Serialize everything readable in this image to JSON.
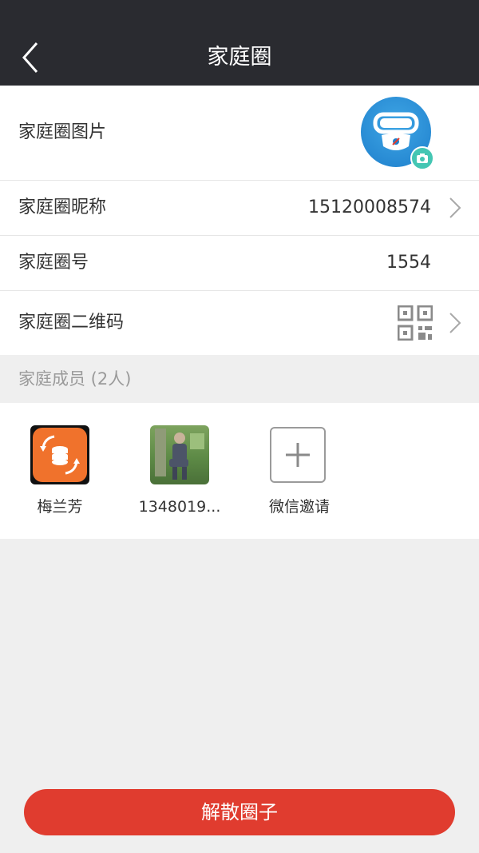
{
  "header": {
    "title": "家庭圈"
  },
  "rows": {
    "picture": {
      "label": "家庭圈图片"
    },
    "nickname": {
      "label": "家庭圈昵称",
      "value": "15120008574"
    },
    "number": {
      "label": "家庭圈号",
      "value": "1554"
    },
    "qrcode": {
      "label": "家庭圈二维码"
    }
  },
  "members_section": {
    "title": "家庭成员 (2人)"
  },
  "members": [
    {
      "name": "梅兰芳"
    },
    {
      "name": "1348019..."
    },
    {
      "name": "微信邀请"
    }
  ],
  "actions": {
    "disband": "解散圈子"
  },
  "colors": {
    "header_bg": "#2a2b30",
    "accent_red": "#e03c2f",
    "page_bg": "#efefef"
  }
}
